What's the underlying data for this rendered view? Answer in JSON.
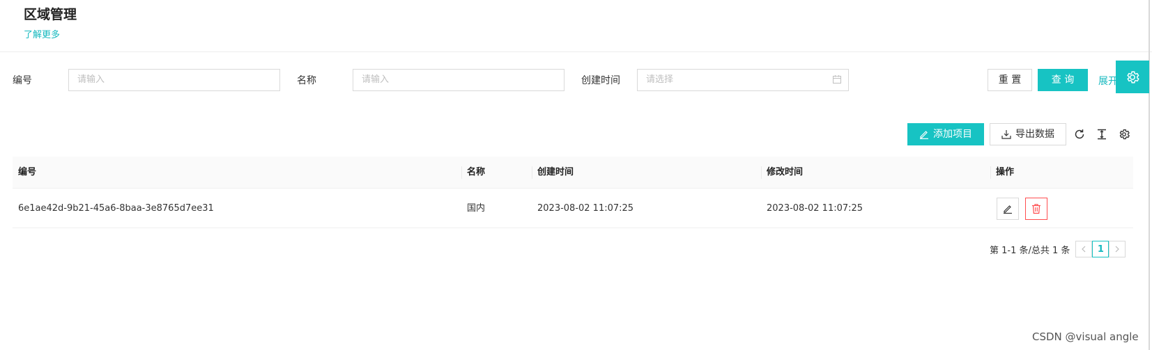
{
  "header": {
    "title": "区域管理",
    "learn_more": "了解更多"
  },
  "filters": {
    "id_label": "编号",
    "id_placeholder": "请输入",
    "name_label": "名称",
    "name_placeholder": "请输入",
    "created_label": "创建时间",
    "created_placeholder": "请选择",
    "reset_label": "重 置",
    "query_label": "查 询",
    "expand_label": "展开"
  },
  "toolbar": {
    "add_label": "添加项目",
    "export_label": "导出数据",
    "icons": [
      "reload-icon",
      "column-height-icon",
      "setting-icon"
    ]
  },
  "table": {
    "columns": [
      "编号",
      "名称",
      "创建时间",
      "修改时间",
      "操作"
    ],
    "rows": [
      {
        "id": "6e1ae42d-9b21-45a6-8baa-3e8765d7ee31",
        "name": "国内",
        "created": "2023-08-02 11:07:25",
        "modified": "2023-08-02 11:07:25"
      }
    ]
  },
  "pagination": {
    "summary": "第 1-1 条/总共 1 条",
    "current_page": "1"
  },
  "watermark": "CSDN @visual angle",
  "colors": {
    "accent": "#17c3c3",
    "danger": "#ff4d4f",
    "link": "#17b9bf"
  }
}
